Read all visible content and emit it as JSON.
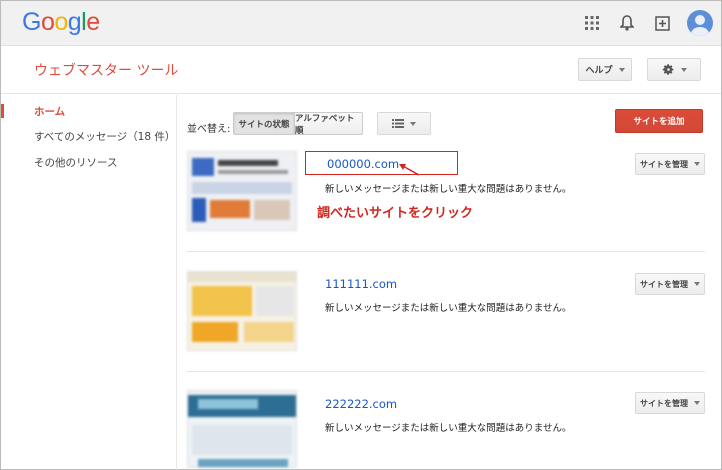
{
  "header": {
    "logo_letters": [
      {
        "ch": "G",
        "color": "#3b78e7"
      },
      {
        "ch": "o",
        "color": "#dd4b39"
      },
      {
        "ch": "o",
        "color": "#f4b400"
      },
      {
        "ch": "g",
        "color": "#3b78e7"
      },
      {
        "ch": "l",
        "color": "#0f9d58"
      },
      {
        "ch": "e",
        "color": "#dd4b39"
      }
    ],
    "icons": [
      "apps-grid-icon",
      "notification-bell-icon",
      "share-plus-icon",
      "account-avatar-icon"
    ]
  },
  "product": {
    "title": "ウェブマスター ツール",
    "help_label": "ヘルプ"
  },
  "sidebar": {
    "items": [
      {
        "label": "ホーム",
        "active": true
      },
      {
        "label": "すべてのメッセージ（18 件）",
        "active": false
      },
      {
        "label": "その他のリソース",
        "active": false
      }
    ]
  },
  "toolbar": {
    "sort_label": "並べ替え:",
    "sort_by_status": "サイトの状態",
    "sort_by_alpha": "アルファベット順",
    "add_site": "サイトを追加"
  },
  "sites": [
    {
      "url": "000000.com",
      "message": "新しいメッセージまたは新しい重大な問題はありません。",
      "manage": "サイトを管理"
    },
    {
      "url": "111111.com",
      "message": "新しいメッセージまたは新しい重大な問題はありません。",
      "manage": "サイトを管理"
    },
    {
      "url": "222222.com",
      "message": "新しいメッセージまたは新しい重大な問題はありません。",
      "manage": "サイトを管理"
    }
  ],
  "annotation": {
    "text": "調べたいサイトをクリック",
    "color": "#d2261e"
  },
  "colors": {
    "accent": "#dd4b39",
    "link": "#1a56c8"
  }
}
